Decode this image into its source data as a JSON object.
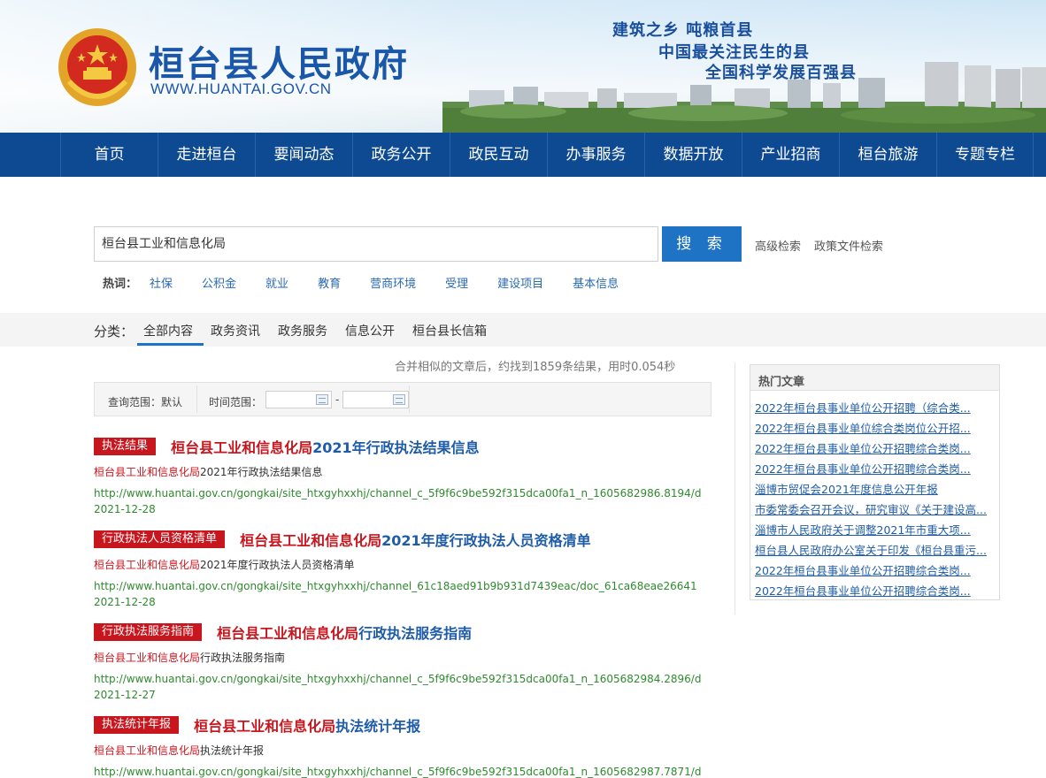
{
  "header": {
    "site_title": "桓台县人民政府",
    "site_url": "WWW.HUANTAI.GOV.CN",
    "slogans": [
      "建筑之乡 吨粮首县",
      "中国最关注民生的县",
      "全国科学发展百强县"
    ]
  },
  "nav": {
    "items": [
      "首页",
      "走进桓台",
      "要闻动态",
      "政务公开",
      "政民互动",
      "办事服务",
      "数据开放",
      "产业招商",
      "桓台旅游",
      "专题专栏"
    ]
  },
  "search": {
    "value": "桓台县工业和信息化局",
    "button_label": "搜 索",
    "advanced_label": "高级检索",
    "policy_label": "政策文件检索",
    "hot_label": "热词：",
    "hot_words": [
      "社保",
      "公积金",
      "就业",
      "教育",
      "营商环境",
      "受理",
      "建设项目",
      "基本信息"
    ]
  },
  "categories": {
    "label": "分类：",
    "tabs": [
      "全部内容",
      "政务资讯",
      "政务服务",
      "信息公开",
      "桓台县长信箱"
    ],
    "active": "全部内容"
  },
  "results_meta": {
    "summary": "合并相似的文章后，约找到1859条结果，用时0.054秒",
    "scope_label": "查询范围：默认",
    "time_label": "时间范围：",
    "date_separator": "-"
  },
  "results": [
    {
      "tag": "执法结果",
      "title_hl": "桓台县工业和信息化局",
      "title_rest": "2021年行政执法结果信息",
      "sub_hl": "桓台县工业和信息化局",
      "sub_rest": "2021年行政执法结果信息",
      "url": "http://www.huantai.gov.cn/gongkai/site_htxgyhxxhj/channel_c_5f9f6c9be592f315dca00fa1_n_1605682986.8194/d",
      "date": "2021-12-28"
    },
    {
      "tag": "行政执法人员资格清单",
      "title_hl": "桓台县工业和信息化局",
      "title_rest": "2021年度行政执法人员资格清单",
      "sub_hl": "桓台县工业和信息化局",
      "sub_rest": "2021年度行政执法人员资格清单",
      "url": "http://www.huantai.gov.cn/gongkai/site_htxgyhxxhj/channel_61c18aed91b9b931d7439eac/doc_61ca68eae26641",
      "date": "2021-12-28"
    },
    {
      "tag": "行政执法服务指南",
      "title_hl": "桓台县工业和信息化局",
      "title_rest": "行政执法服务指南",
      "sub_hl": "桓台县工业和信息化局",
      "sub_rest": "行政执法服务指南",
      "url": "http://www.huantai.gov.cn/gongkai/site_htxgyhxxhj/channel_c_5f9f6c9be592f315dca00fa1_n_1605682984.2896/d",
      "date": "2021-12-27"
    },
    {
      "tag": "执法统计年报",
      "title_hl": "桓台县工业和信息化局",
      "title_rest": "执法统计年报",
      "sub_hl": "桓台县工业和信息化局",
      "sub_rest": "执法统计年报",
      "url": "http://www.huantai.gov.cn/gongkai/site_htxgyhxxhj/channel_c_5f9f6c9be592f315dca00fa1_n_1605682987.7871/d",
      "date": ""
    }
  ],
  "sidebar": {
    "title": "热门文章",
    "items": [
      "2022年桓台县事业单位公开招聘（综合类...",
      "2022年桓台县事业单位综合类岗位公开招...",
      "2022年桓台县事业单位公开招聘综合类岗...",
      "2022年桓台县事业单位公开招聘综合类岗...",
      "淄博市贸促会2021年度信息公开年报",
      "市委常委会召开会议，研究审议《关于建设高...",
      "淄博市人民政府关于调整2021年市重大项...",
      "桓台县人民政府办公室关于印发《桓台县重污...",
      "2022年桓台县事业单位公开招聘综合类岗...",
      "2022年桓台县事业单位公开招聘综合类岗..."
    ]
  },
  "colors": {
    "nav_bg": "#0d4a92",
    "brand_blue": "#1b57a8",
    "search_button": "#1e73c4",
    "tag_red": "#c8161e",
    "url_green": "#2f8a2f"
  },
  "icons": [
    "national-emblem-icon",
    "calendar-icon"
  ]
}
